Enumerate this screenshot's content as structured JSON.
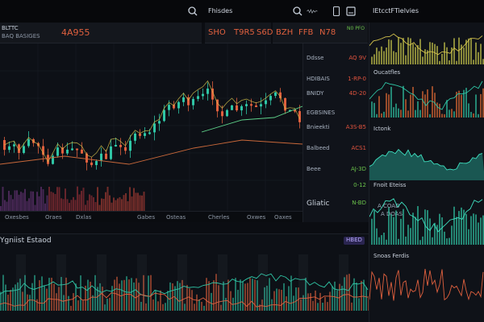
{
  "topbar": {
    "left_label": "Fhisdes",
    "right_label": "IEtcctFTielvies",
    "icons": [
      "search-icon",
      "search-icon",
      "waveform-icon",
      "phone-icon",
      "square-icon"
    ]
  },
  "strip": {
    "code": "BLTTC",
    "sub": "BAQ BASIGES",
    "main_value": "4A955",
    "values": [
      "SHO",
      "T9R5",
      "S6D"
    ],
    "right_values": [
      "BZH",
      "FFB",
      "N78"
    ],
    "right_small": "N0 PFO"
  },
  "right_list": {
    "header": "Ddsse",
    "items": [
      {
        "name": "Ddsse",
        "value": "AQ 9V",
        "color": "#e0533e"
      },
      {
        "name": "HDIBAIS",
        "value": "1-RP-0",
        "color": "#e0533e"
      },
      {
        "name": "BNIDY",
        "value": "4D-20",
        "color": "#e0533e"
      },
      {
        "name": "EGBSINES",
        "value": "",
        "color": "#e0533e"
      },
      {
        "name": "Bnieekti",
        "value": "A3S-B5",
        "color": "#e0533e"
      },
      {
        "name": "Balbeed",
        "value": "ACS1",
        "color": "#e0533e"
      },
      {
        "name": "Beee",
        "value": "AJ-3D",
        "color": "#6ac24a"
      },
      {
        "name": "",
        "value": "0-12",
        "color": "#6ac24a"
      },
      {
        "name": "Gliatic",
        "value": "N-BD",
        "color": "#6ac24a"
      }
    ]
  },
  "axis_labels": [
    "Oxesbes",
    "Oraes",
    "Dxlas",
    "Gabes",
    "Osteas",
    "Cherles",
    "Oxwes",
    "Oaxes"
  ],
  "lower": {
    "title": "Ygniist Estaod",
    "badge": "HBED"
  },
  "side_panels": [
    {
      "title": "Oucatfles"
    },
    {
      "title": "Ictonk"
    },
    {
      "title": "Fnoit Eteiss",
      "badge": "A COAD",
      "sub": "A DOAS"
    },
    {
      "title": "Snoas Ferdis"
    }
  ],
  "colors": {
    "bull": "#2fc5a5",
    "bear": "#e0603e",
    "accent": "#d3c24c",
    "bg": "#0b0d12"
  }
}
